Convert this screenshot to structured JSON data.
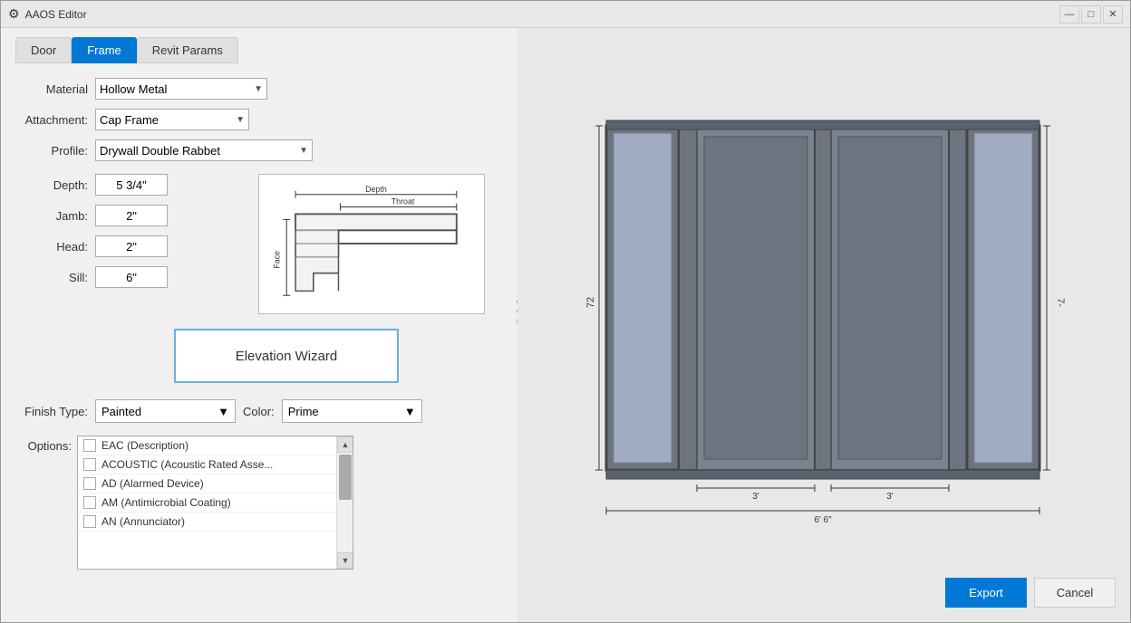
{
  "window": {
    "title": "AAOS Editor",
    "icon": "⚙"
  },
  "tabs": [
    {
      "id": "door",
      "label": "Door",
      "active": false
    },
    {
      "id": "frame",
      "label": "Frame",
      "active": true
    },
    {
      "id": "revit",
      "label": "Revit Params",
      "active": false
    }
  ],
  "form": {
    "material_label": "Material",
    "material_value": "Hollow Metal",
    "attachment_label": "Attachment:",
    "attachment_value": "Cap Frame",
    "profile_label": "Profile:",
    "profile_value": "Drywall Double Rabbet",
    "depth_label": "Depth:",
    "depth_value": "5 3/4\"",
    "jamb_label": "Jamb:",
    "jamb_value": "2\"",
    "head_label": "Head:",
    "head_value": "2\"",
    "sill_label": "Sill:",
    "sill_value": "6\""
  },
  "elevation_wizard": {
    "label": "Elevation Wizard"
  },
  "finish": {
    "type_label": "Finish Type:",
    "type_value": "Painted",
    "color_label": "Color:",
    "color_value": "Prime"
  },
  "options": {
    "label": "Options:",
    "items": [
      {
        "id": "eac",
        "label": "EAC (Description)"
      },
      {
        "id": "acoustic",
        "label": "ACOUSTIC (Acoustic Rated Asse..."
      },
      {
        "id": "ad",
        "label": "AD (Alarmed Device)"
      },
      {
        "id": "am",
        "label": "AM (Antimicrobial Coating)"
      },
      {
        "id": "an",
        "label": "AN (Annunciator)"
      }
    ]
  },
  "buttons": {
    "export_label": "Export",
    "cancel_label": "Cancel"
  },
  "titlebar_controls": {
    "minimize": "—",
    "maximize": "□",
    "close": "✕"
  },
  "diagram": {
    "depth_label": "Depth",
    "throat_label": "Throat",
    "face_label": "Face"
  },
  "elevation": {
    "dim_72": "72",
    "dim_7": "7-",
    "dim_3_left": "3'",
    "dim_3_right": "3'",
    "dim_66": "6' 6\""
  }
}
